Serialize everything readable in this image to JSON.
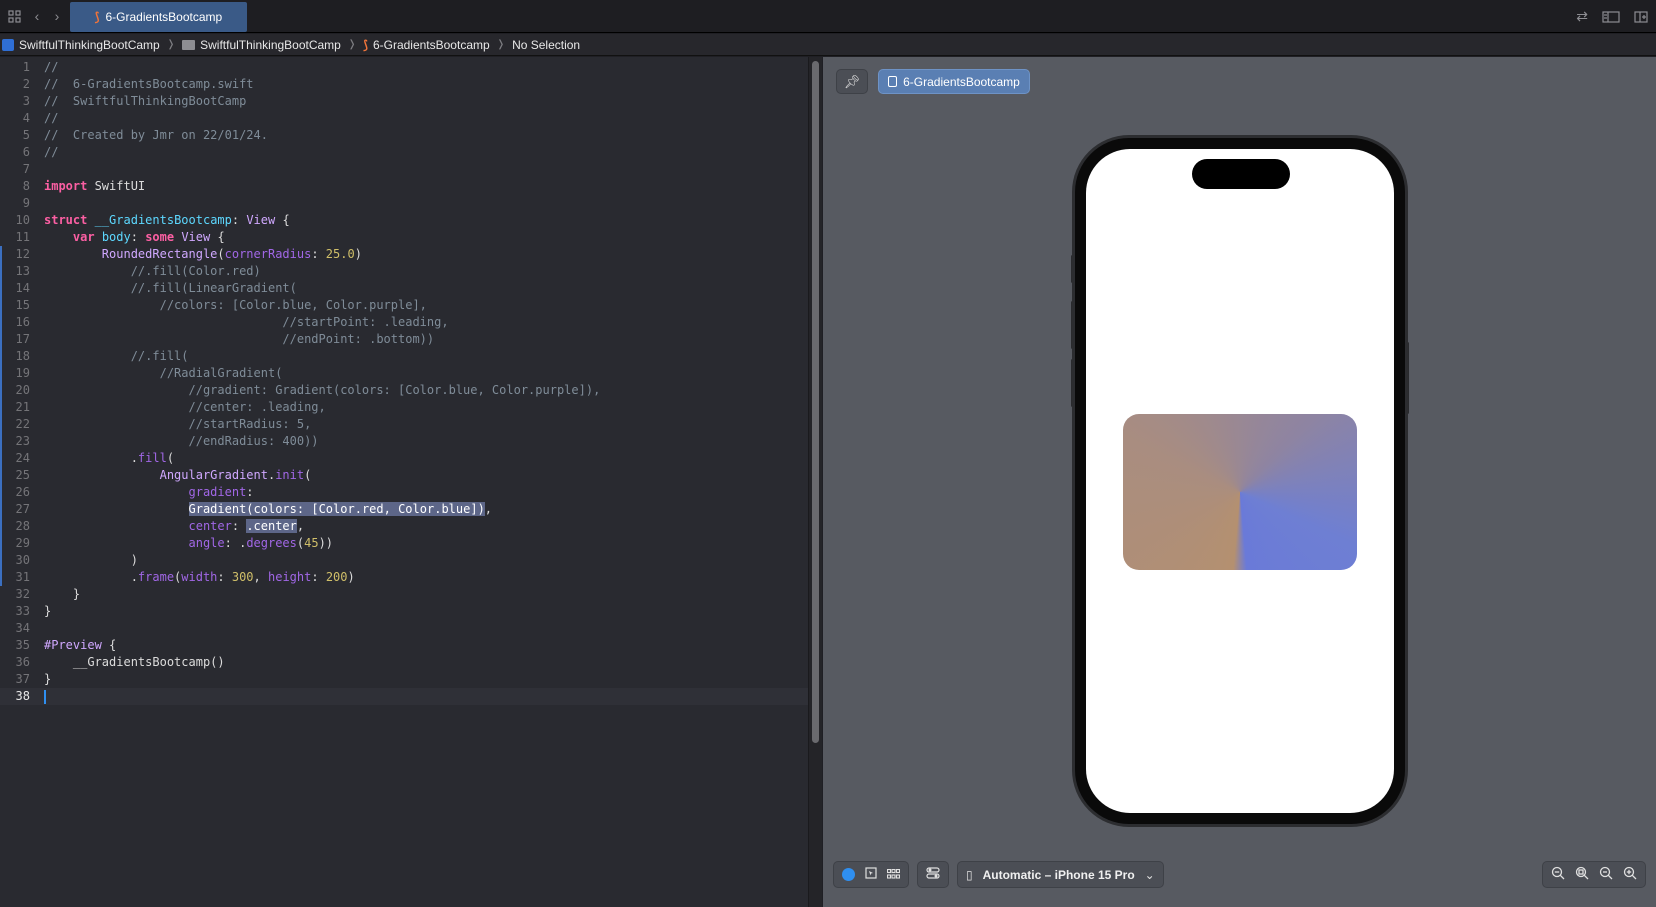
{
  "tabbar": {
    "tab_label": "6-GradientsBootcamp"
  },
  "breadcrumb": [
    {
      "label": "SwiftfulThinkingBootCamp",
      "icon": "project-icon"
    },
    {
      "label": "SwiftfulThinkingBootCamp",
      "icon": "folder-icon"
    },
    {
      "label": "6-GradientsBootcamp",
      "icon": "swift-file-icon"
    },
    {
      "label": "No Selection",
      "icon": ""
    }
  ],
  "editor": {
    "current_line": 38,
    "changed_lines_from": 12,
    "changed_lines_to": 31,
    "lines": [
      [
        {
          "t": "//",
          "c": "cmt"
        }
      ],
      [
        {
          "t": "//  6-GradientsBootcamp.swift",
          "c": "cmt"
        }
      ],
      [
        {
          "t": "//  SwiftfulThinkingBootCamp",
          "c": "cmt"
        }
      ],
      [
        {
          "t": "//",
          "c": "cmt"
        }
      ],
      [
        {
          "t": "//  Created by Jmr on 22/01/24.",
          "c": "cmt"
        }
      ],
      [
        {
          "t": "//",
          "c": "cmt"
        }
      ],
      [],
      [
        {
          "t": "import",
          "c": "kw"
        },
        {
          "t": " SwiftUI",
          "c": ""
        }
      ],
      [],
      [
        {
          "t": "struct",
          "c": "kw"
        },
        {
          "t": " ",
          "c": ""
        },
        {
          "t": "__GradientsBootcamp",
          "c": "tyd"
        },
        {
          "t": ": ",
          "c": ""
        },
        {
          "t": "View",
          "c": "ty"
        },
        {
          "t": " {",
          "c": ""
        }
      ],
      [
        {
          "t": "    ",
          "c": ""
        },
        {
          "t": "var",
          "c": "kw"
        },
        {
          "t": " ",
          "c": ""
        },
        {
          "t": "body",
          "c": "tyd"
        },
        {
          "t": ": ",
          "c": ""
        },
        {
          "t": "some",
          "c": "kw"
        },
        {
          "t": " ",
          "c": ""
        },
        {
          "t": "View",
          "c": "ty"
        },
        {
          "t": " {",
          "c": ""
        }
      ],
      [
        {
          "t": "        ",
          "c": ""
        },
        {
          "t": "RoundedRectangle",
          "c": "ty"
        },
        {
          "t": "(",
          "c": ""
        },
        {
          "t": "cornerRadius",
          "c": "prop"
        },
        {
          "t": ": ",
          "c": ""
        },
        {
          "t": "25.0",
          "c": "num"
        },
        {
          "t": ")",
          "c": ""
        }
      ],
      [
        {
          "t": "            //.fill(Color.red)",
          "c": "cmt"
        }
      ],
      [
        {
          "t": "            //.fill(LinearGradient(",
          "c": "cmt"
        }
      ],
      [
        {
          "t": "                //colors: [Color.blue, Color.purple],",
          "c": "cmt"
        }
      ],
      [
        {
          "t": "                                 //startPoint: .leading,",
          "c": "cmt"
        }
      ],
      [
        {
          "t": "                                 //endPoint: .bottom))",
          "c": "cmt"
        }
      ],
      [
        {
          "t": "            //.fill(",
          "c": "cmt"
        }
      ],
      [
        {
          "t": "                //RadialGradient(",
          "c": "cmt"
        }
      ],
      [
        {
          "t": "                    //gradient: Gradient(colors: [Color.blue, Color.purple]),",
          "c": "cmt"
        }
      ],
      [
        {
          "t": "                    //center: .leading,",
          "c": "cmt"
        }
      ],
      [
        {
          "t": "                    //startRadius: 5,",
          "c": "cmt"
        }
      ],
      [
        {
          "t": "                    //endRadius: 400))",
          "c": "cmt"
        }
      ],
      [
        {
          "t": "            .",
          "c": ""
        },
        {
          "t": "fill",
          "c": "prop"
        },
        {
          "t": "(",
          "c": ""
        }
      ],
      [
        {
          "t": "                ",
          "c": ""
        },
        {
          "t": "AngularGradient",
          "c": "ty"
        },
        {
          "t": ".",
          "c": ""
        },
        {
          "t": "init",
          "c": "prop"
        },
        {
          "t": "(",
          "c": ""
        }
      ],
      [
        {
          "t": "                    ",
          "c": ""
        },
        {
          "t": "gradient",
          "c": "prop"
        },
        {
          "t": ":",
          "c": ""
        }
      ],
      [
        {
          "t": "                    ",
          "c": ""
        },
        {
          "t": "Gradient(",
          "c": "ty sel"
        },
        {
          "t": "colors",
          "c": "prop sel"
        },
        {
          "t": ": [",
          "c": "sel"
        },
        {
          "t": "Color",
          "c": "ty sel"
        },
        {
          "t": ".",
          "c": "sel"
        },
        {
          "t": "red",
          "c": "prop sel"
        },
        {
          "t": ", ",
          "c": "sel"
        },
        {
          "t": "Color",
          "c": "ty sel"
        },
        {
          "t": ".",
          "c": "sel"
        },
        {
          "t": "blue",
          "c": "prop sel"
        },
        {
          "t": "])",
          "c": "sel"
        },
        {
          "t": ",",
          "c": ""
        }
      ],
      [
        {
          "t": "                    ",
          "c": ""
        },
        {
          "t": "center",
          "c": "prop"
        },
        {
          "t": ": ",
          "c": ""
        },
        {
          "t": ".center",
          "c": "prop sel"
        },
        {
          "t": ",",
          "c": ""
        }
      ],
      [
        {
          "t": "                    ",
          "c": ""
        },
        {
          "t": "angle",
          "c": "prop"
        },
        {
          "t": ": .",
          "c": ""
        },
        {
          "t": "degrees",
          "c": "prop"
        },
        {
          "t": "(",
          "c": ""
        },
        {
          "t": "45",
          "c": "num"
        },
        {
          "t": "))",
          "c": ""
        }
      ],
      [
        {
          "t": "            )",
          "c": ""
        }
      ],
      [
        {
          "t": "            .",
          "c": ""
        },
        {
          "t": "frame",
          "c": "prop"
        },
        {
          "t": "(",
          "c": ""
        },
        {
          "t": "width",
          "c": "prop"
        },
        {
          "t": ": ",
          "c": ""
        },
        {
          "t": "300",
          "c": "num"
        },
        {
          "t": ", ",
          "c": ""
        },
        {
          "t": "height",
          "c": "prop"
        },
        {
          "t": ": ",
          "c": ""
        },
        {
          "t": "200",
          "c": "num"
        },
        {
          "t": ")",
          "c": ""
        }
      ],
      [
        {
          "t": "    }",
          "c": ""
        }
      ],
      [
        {
          "t": "}",
          "c": ""
        }
      ],
      [],
      [
        {
          "t": "#Preview",
          "c": "ty"
        },
        {
          "t": " {",
          "c": ""
        }
      ],
      [
        {
          "t": "    __GradientsBootcamp()",
          "c": ""
        }
      ],
      [
        {
          "t": "}",
          "c": ""
        }
      ],
      []
    ]
  },
  "canvas": {
    "preview_tab_label": "6-GradientsBootcamp",
    "device_selector_label": "Automatic – iPhone 15 Pro",
    "gradient": {
      "type": "angular",
      "colors": [
        "red",
        "blue"
      ],
      "angle_degrees": 45,
      "center": "center"
    }
  },
  "colors": {
    "accent": "#3a5a87",
    "preview_tab": "#5a7fb3",
    "canvas_bg": "#575a61",
    "editor_bg": "#292a30"
  }
}
